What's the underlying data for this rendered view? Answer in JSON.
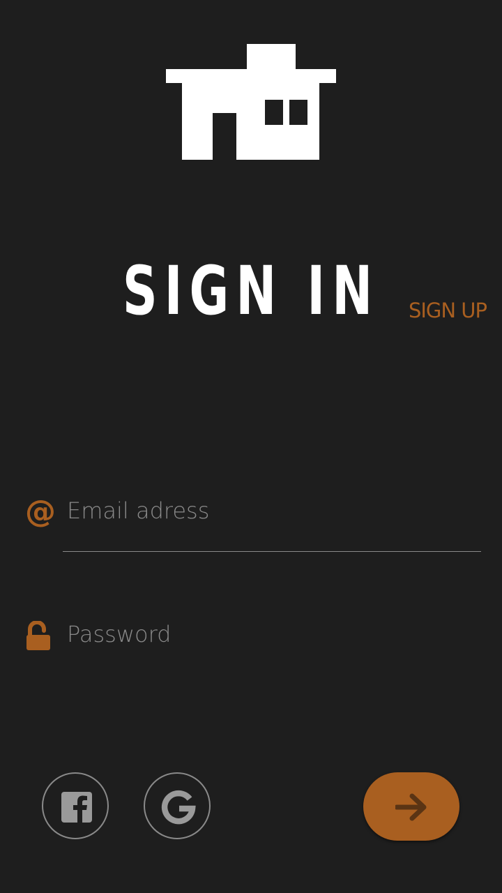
{
  "header": {
    "logo_icon": "house-icon"
  },
  "title": "SIGN IN",
  "signup_link": "SIGN UP",
  "form": {
    "email": {
      "icon": "at-icon",
      "icon_glyph": "@",
      "placeholder": "Email adress",
      "value": ""
    },
    "password": {
      "icon": "unlocked-lock-icon",
      "placeholder": "Password",
      "value": ""
    }
  },
  "social": [
    {
      "icon": "facebook-icon"
    },
    {
      "icon": "google-icon"
    }
  ],
  "submit": {
    "icon": "arrow-right-icon"
  },
  "colors": {
    "background": "#1e1e1e",
    "accent": "#a95f20",
    "text": "#ffffff",
    "muted": "#8a8a8a"
  }
}
